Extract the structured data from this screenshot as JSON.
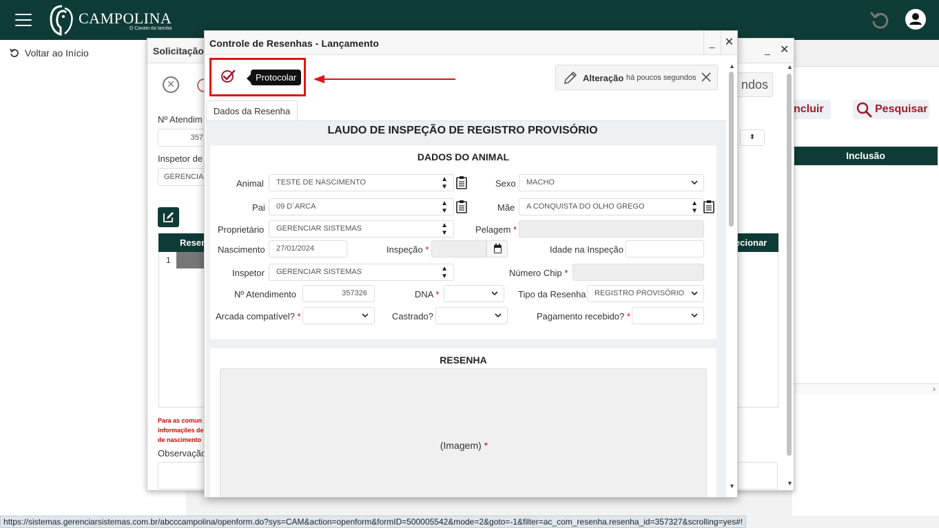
{
  "brand": {
    "name": "CAMPOLINA",
    "tagline": "O Cavalo da família"
  },
  "nav": {
    "back_label": "Voltar ao Início"
  },
  "background_page": {
    "incluir_label": "ncluir",
    "pesquisar_label": "Pesquisar",
    "inclusao_header": "Inclusão"
  },
  "bg_dialog": {
    "title": "Solicitação",
    "atendimento_label": "Nº Atendim",
    "atendimento_value": "357",
    "inspetor_label": "Inspetor de",
    "inspetor_value": "GERENCIA",
    "table_header_left": "Resen",
    "table_header_right": "ecionar",
    "row_number": "1",
    "note": "Para as comun\ninformações de\nde nascimento",
    "observacao_label": "Observação",
    "toast_text": "ndos"
  },
  "dialog": {
    "title": "Controle de Resenhas - Lançamento",
    "minimize": "_",
    "close": "✕",
    "tooltip": "Protocolar",
    "toast": {
      "title": "Alteração",
      "time": "há poucos segundos"
    },
    "tab": "Dados da Resenha",
    "laudo_title": "LAUDO DE INSPEÇÃO DE REGISTRO PROVISÓRIO",
    "section_animal": "DADOS DO ANIMAL",
    "section_resenha": "RESENHA",
    "fields": {
      "animal_label": "Animal",
      "animal_value": "TESTE DE NASCIMENTO",
      "sexo_label": "Sexo",
      "sexo_value": "MACHO",
      "pai_label": "Pai",
      "pai_value": "09 D´ARCA",
      "mae_label": "Mãe",
      "mae_value": "A CONQUISTA DO OLHO GREGO",
      "proprietario_label": "Proprietário",
      "proprietario_value": "GERENCIAR SISTEMAS",
      "pelagem_label": "Pelagem",
      "nascimento_label": "Nascimento",
      "nascimento_value": "27/01/2024",
      "inspecao_label": "Inspeção",
      "idade_label": "Idade na Inspeção",
      "inspetor_label": "Inspetor",
      "inspetor_value": "GERENCIAR SISTEMAS",
      "chip_label": "Número Chip",
      "atendimento_label": "Nº Atendimento",
      "atendimento_value": "357326",
      "dna_label": "DNA",
      "tipo_label": "Tipo da Resenha",
      "tipo_value": "REGISTRO PROVISÓRIO",
      "arcada_label": "Arcada compatível?",
      "castrado_label": "Castrado?",
      "pagamento_label": "Pagamento recebido?",
      "required_mark": "*"
    },
    "image_label": "(Imagem)"
  },
  "statusbar": {
    "url": "https://sistemas.gerenciarsistemas.com.br/abcccampolina/openform.do?sys=CAM&action=openform&formID=500005542&mode=2&goto=-1&filter=ac_com_resenha.resenha_id=357327&scrolling=yes#!"
  },
  "colors": {
    "topbar": "#0f3b37",
    "highlight": "#e01313",
    "accent": "#a11a2a"
  },
  "icons": [
    "hamburger-icon",
    "campolina-logo",
    "undo-icon",
    "user-icon",
    "undo-back-icon",
    "check-circle-icon",
    "pencil-icon",
    "close-icon",
    "clipboard-icon",
    "calendar-icon",
    "chevron-down-icon",
    "search-icon",
    "edit-icon"
  ]
}
